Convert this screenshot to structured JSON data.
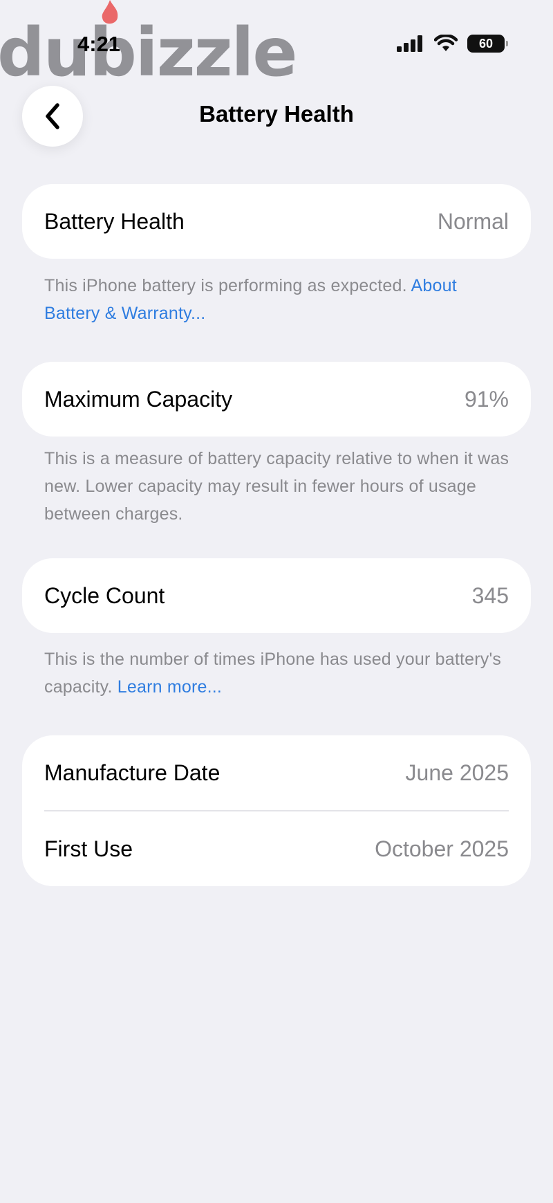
{
  "status_bar": {
    "time": "4:21",
    "battery_level": "60"
  },
  "watermark": {
    "text": "dubizzle"
  },
  "nav": {
    "title": "Battery Health",
    "back_icon": "chevron-left-icon"
  },
  "battery_health": {
    "label": "Battery Health",
    "value": "Normal",
    "note": "This iPhone battery is performing as expected.",
    "link": "About Battery & Warranty..."
  },
  "maximum_capacity": {
    "label": "Maximum Capacity",
    "value": "91%",
    "note": "This is a measure of battery capacity relative to when it was new. Lower capacity may result in fewer hours of usage between charges."
  },
  "cycle_count": {
    "label": "Cycle Count",
    "value": "345",
    "note": "This is the number of times iPhone has used your battery's capacity.",
    "link": "Learn more..."
  },
  "dates": {
    "manufacture_label": "Manufacture Date",
    "manufacture_value": "June 2025",
    "first_use_label": "First Use",
    "first_use_value": "October 2025"
  },
  "colors": {
    "background": "#f0f0f5",
    "link": "#2f7de0",
    "secondary_text": "#8a8a8e"
  }
}
